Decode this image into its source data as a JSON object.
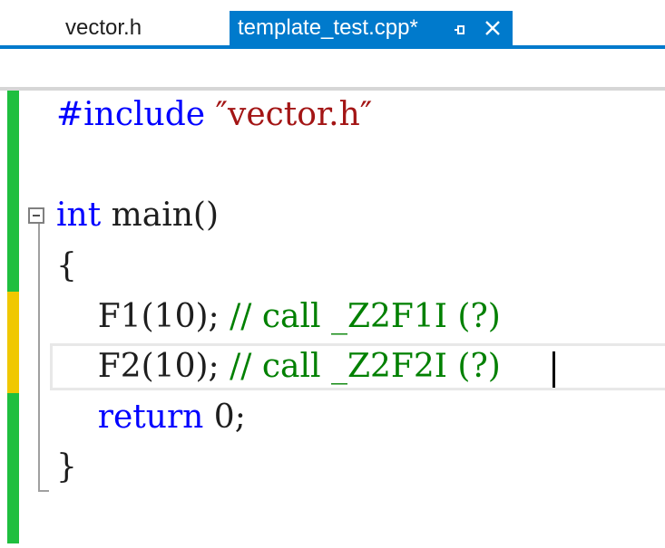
{
  "tabs": [
    {
      "label": "vector.h",
      "active": false
    },
    {
      "label": "template_test.cpp*",
      "active": true
    }
  ],
  "tab_icons": {
    "pin": "pin-icon",
    "close": "close-icon"
  },
  "colors": {
    "accent": "#007acc",
    "preprocessor": "#0000ff",
    "keyword": "#0000ff",
    "string": "#a31515",
    "comment": "#008000",
    "text": "#1e1e1e",
    "changed_saved": "#1fbf3f",
    "changed_unsaved": "#f0c800"
  },
  "editor": {
    "lines": [
      {
        "tokens": [
          {
            "text": "#include",
            "kind": "preprocessor"
          },
          {
            "text": " ",
            "kind": "text"
          },
          {
            "text": "″vector.h″",
            "kind": "string"
          }
        ]
      },
      {
        "tokens": []
      },
      {
        "tokens": [
          {
            "text": "int",
            "kind": "keyword"
          },
          {
            "text": " main()",
            "kind": "text"
          }
        ]
      },
      {
        "tokens": [
          {
            "text": "{",
            "kind": "text"
          }
        ]
      },
      {
        "tokens": [
          {
            "text": "    F1(10); ",
            "kind": "text"
          },
          {
            "text": "// call _Z2F1I (?)",
            "kind": "comment"
          }
        ]
      },
      {
        "tokens": [
          {
            "text": "    F2(10); ",
            "kind": "text"
          },
          {
            "text": "// call _Z2F2I (?)",
            "kind": "comment"
          }
        ]
      },
      {
        "tokens": [
          {
            "text": "    ",
            "kind": "text"
          },
          {
            "text": "return",
            "kind": "keyword"
          },
          {
            "text": " 0;",
            "kind": "text"
          }
        ]
      },
      {
        "tokens": [
          {
            "text": "}",
            "kind": "text"
          }
        ]
      }
    ],
    "change_markers": [
      {
        "state": "saved"
      },
      {
        "state": "unsaved"
      },
      {
        "state": "saved"
      }
    ],
    "collapse_icon": "collapse-minus-icon"
  }
}
